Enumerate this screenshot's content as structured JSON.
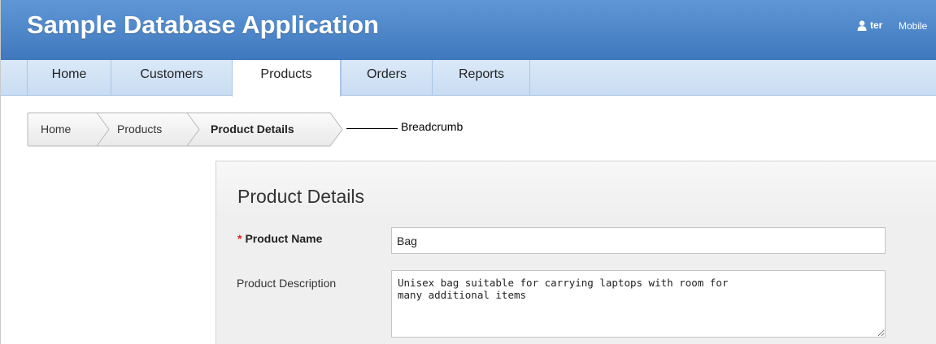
{
  "header": {
    "app_title": "Sample Database Application",
    "username": "ter",
    "mobile_link": "Mobile",
    "colors": {
      "header_blue": "#4a84c8",
      "tab_bar": "#cfe1f5"
    }
  },
  "tabs": [
    {
      "label": "Home",
      "active": false
    },
    {
      "label": "Customers",
      "active": false
    },
    {
      "label": "Products",
      "active": true
    },
    {
      "label": "Orders",
      "active": false
    },
    {
      "label": "Reports",
      "active": false
    }
  ],
  "breadcrumb": {
    "items": [
      {
        "label": "Home"
      },
      {
        "label": "Products"
      },
      {
        "label": "Product Details",
        "current": true
      }
    ],
    "callout": "Breadcrumb"
  },
  "region": {
    "title": "Product Details",
    "fields": {
      "product_name": {
        "label": "Product Name",
        "required": true,
        "required_marker": "*",
        "value": "Bag"
      },
      "product_description": {
        "label": "Product Description",
        "value": "Unisex bag suitable for carrying laptops with room for\nmany additional items"
      }
    }
  },
  "icons": {
    "user": "user-icon",
    "resize": "resize-grip-icon"
  }
}
